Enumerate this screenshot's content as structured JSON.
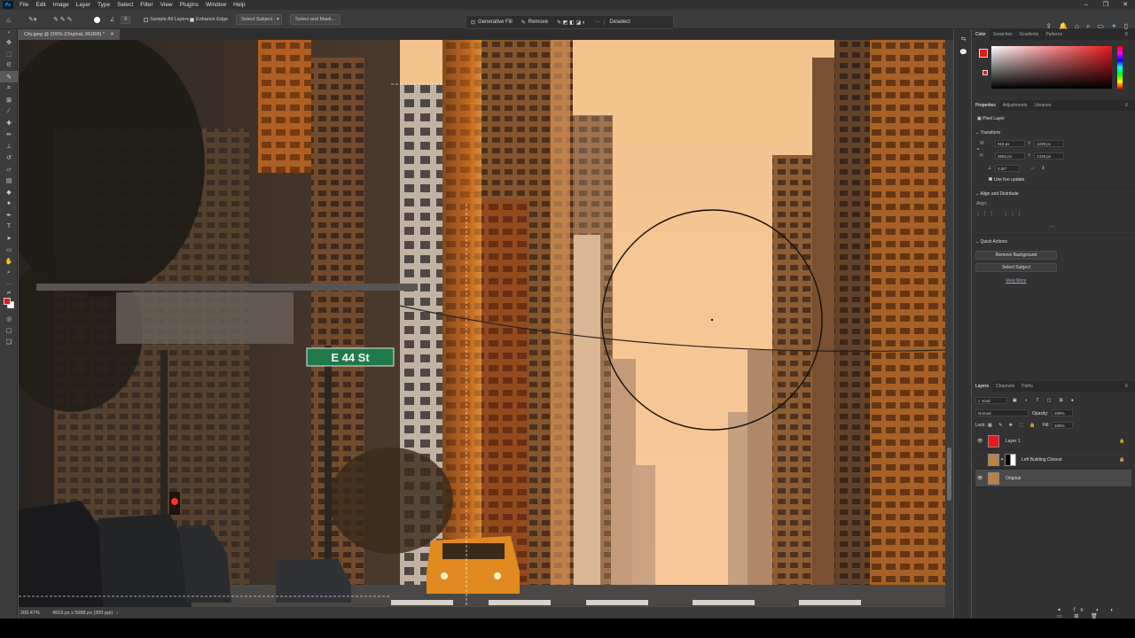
{
  "app": {
    "logo": "Ps"
  },
  "menu": [
    "File",
    "Edit",
    "Image",
    "Layer",
    "Type",
    "Select",
    "Filter",
    "View",
    "Plugins",
    "Window",
    "Help"
  ],
  "window_controls": {
    "minimize": "–",
    "restore": "❐",
    "close": "✕"
  },
  "options_bar": {
    "brush_size": "9",
    "sample_all_layers": "Sample All Layers",
    "enhance_edge": "Enhance Edge",
    "select_subject": "Select Subject",
    "select_and_mask": "Select and Mask..."
  },
  "context_bar": {
    "generative_fill": "Generative Fill",
    "remove": "Remove",
    "deselect": "Deselect",
    "more": "···"
  },
  "document": {
    "tab_title": "City.jpeg @ 200% (Original, RGB/8) *",
    "zoom": "200.47%",
    "doc_info": "4919 px x 5988 px (300 ppi)",
    "street_sign": "E 44 St"
  },
  "color_panel": {
    "tabs": [
      "Color",
      "Swatches",
      "Gradients",
      "Patterns"
    ],
    "fg_color": "#e8191d",
    "bg_color": "#ffffff"
  },
  "properties_panel": {
    "tabs": [
      "Properties",
      "Adjustments",
      "Libraries"
    ],
    "kind": "Pixel Layer",
    "transform_title": "Transform",
    "w_label": "W",
    "w_value": "915 px",
    "h_label": "H",
    "h_value": "3862 px",
    "x_label": "X",
    "x_value": "1239 px",
    "y_label": "Y",
    "y_value": "1319 px",
    "angle_value": "0.00°",
    "use_live_update": "Use live update",
    "align_title": "Align and Distribute",
    "align_label": "Align:",
    "align_more": "···",
    "quick_actions_title": "Quick Actions",
    "remove_background": "Remove Background",
    "select_subject": "Select Subject",
    "view_more": "View More"
  },
  "layers_panel": {
    "tabs": [
      "Layers",
      "Channels",
      "Paths"
    ],
    "filter": "Kind",
    "blend_mode": "Normal",
    "opacity_label": "Opacity:",
    "opacity_value": "100%",
    "lock_label": "Lock:",
    "fill_label": "Fill:",
    "fill_value": "100%",
    "layers": [
      {
        "name": "Layer 1",
        "visible": true,
        "locked": true,
        "thumb": "#e8191d"
      },
      {
        "name": "Left Building Closest",
        "visible": false,
        "locked": true,
        "thumb": "#c08040"
      },
      {
        "name": "Original",
        "visible": true,
        "locked": false,
        "thumb": "#c08040"
      }
    ]
  }
}
